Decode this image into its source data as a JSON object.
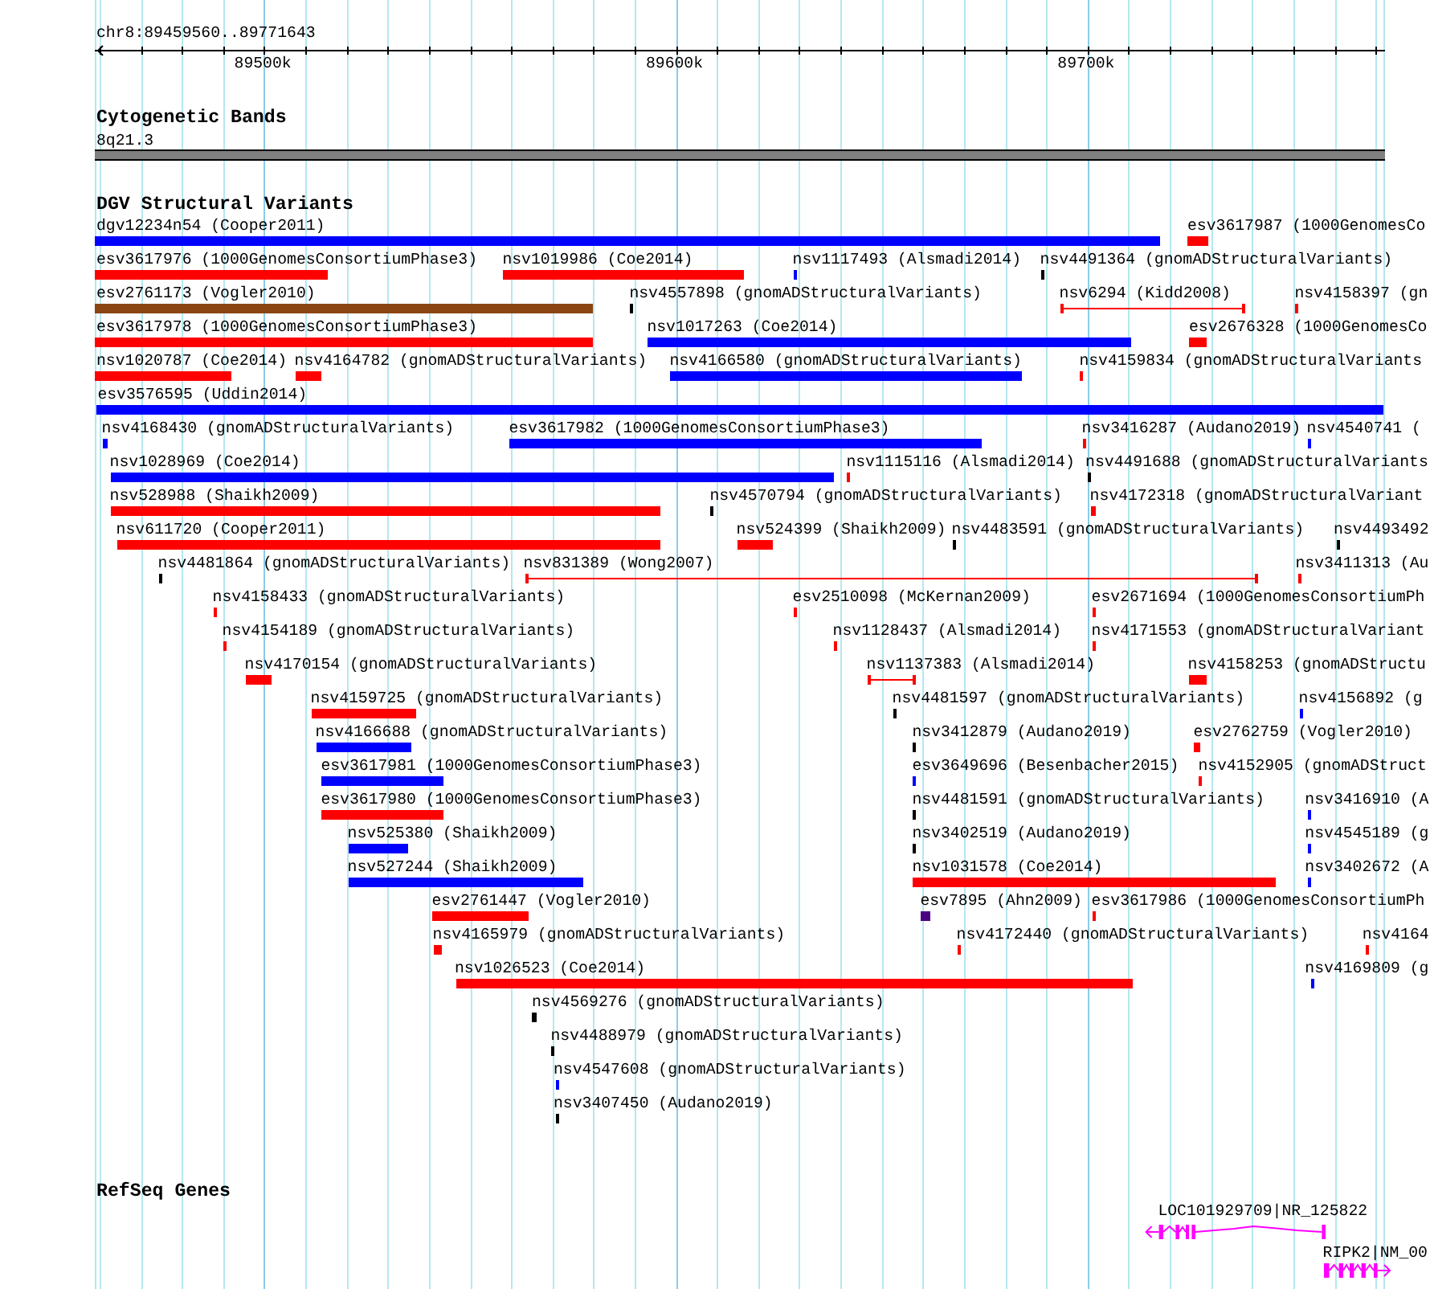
{
  "ruler": {
    "region": "chr8:89459560..89771643",
    "ticks": [
      "89500k",
      "89600k",
      "89700k"
    ]
  },
  "cytogenetic_bands": {
    "title": "Cytogenetic Bands",
    "band": {
      "label": "8q21.3"
    }
  },
  "dgv_variants": {
    "title": "DGV Structural Variants",
    "features": [
      {
        "label": "dgv12234n54 (Cooper2011)",
        "color": "#0000ff",
        "kind": "bar"
      },
      {
        "label": "esv3617987 (1000GenomesCo",
        "color": "#ff0000",
        "kind": "bar"
      },
      {
        "label": "esv3617976 (1000GenomesConsortiumPhase3)",
        "color": "#ff0000",
        "kind": "bar"
      },
      {
        "label": "nsv1019986 (Coe2014)",
        "color": "#ff0000",
        "kind": "bar"
      },
      {
        "label": "nsv1117493 (Alsmadi2014)",
        "color": "#0000ff",
        "kind": "bar"
      },
      {
        "label": "nsv4491364 (gnomADStructuralVariants)",
        "color": "#000000",
        "kind": "bar"
      },
      {
        "label": "esv2761173 (Vogler2010)",
        "color": "#8b4513",
        "kind": "bar"
      },
      {
        "label": "nsv4557898 (gnomADStructuralVariants)",
        "color": "#000000",
        "kind": "bar"
      },
      {
        "label": "nsv6294 (Kidd2008)",
        "color": "#ff0000",
        "kind": "span"
      },
      {
        "label": "nsv4158397 (gn",
        "color": "#ff0000",
        "kind": "bar"
      },
      {
        "label": "esv3617978 (1000GenomesConsortiumPhase3)",
        "color": "#ff0000",
        "kind": "bar"
      },
      {
        "label": "nsv1017263 (Coe2014)",
        "color": "#0000ff",
        "kind": "bar"
      },
      {
        "label": "esv2676328 (1000GenomesCo",
        "color": "#ff0000",
        "kind": "bar"
      },
      {
        "label": "nsv1020787 (Coe2014)",
        "color": "#ff0000",
        "kind": "bar"
      },
      {
        "label": "nsv4164782 (gnomADStructuralVariants)",
        "color": "#ff0000",
        "kind": "bar"
      },
      {
        "label": "nsv4166580 (gnomADStructuralVariants)",
        "color": "#0000ff",
        "kind": "bar"
      },
      {
        "label": "nsv4159834 (gnomADStructuralVariants",
        "color": "#ff0000",
        "kind": "bar"
      },
      {
        "label": "esv3576595 (Uddin2014)",
        "color": "#0000ff",
        "kind": "bar"
      },
      {
        "label": "nsv4168430 (gnomADStructuralVariants)",
        "color": "#0000ff",
        "kind": "bar"
      },
      {
        "label": "esv3617982 (1000GenomesConsortiumPhase3)",
        "color": "#0000ff",
        "kind": "bar"
      },
      {
        "label": "nsv3416287 (Audano2019)",
        "color": "#ff0000",
        "kind": "bar"
      },
      {
        "label": "nsv4540741 (",
        "color": "#0000ff",
        "kind": "bar"
      },
      {
        "label": "nsv1028969 (Coe2014)",
        "color": "#0000ff",
        "kind": "bar"
      },
      {
        "label": "nsv1115116 (Alsmadi2014)",
        "color": "#ff0000",
        "kind": "bar"
      },
      {
        "label": "nsv4491688 (gnomADStructuralVariants",
        "color": "#000000",
        "kind": "bar"
      },
      {
        "label": "nsv528988 (Shaikh2009)",
        "color": "#ff0000",
        "kind": "bar"
      },
      {
        "label": "nsv4570794 (gnomADStructuralVariants)",
        "color": "#000000",
        "kind": "bar"
      },
      {
        "label": "nsv4172318 (gnomADStructuralVariant",
        "color": "#ff0000",
        "kind": "bar"
      },
      {
        "label": "nsv611720 (Cooper2011)",
        "color": "#ff0000",
        "kind": "bar"
      },
      {
        "label": "nsv524399 (Shaikh2009)",
        "color": "#ff0000",
        "kind": "bar"
      },
      {
        "label": "nsv4483591 (gnomADStructuralVariants)",
        "color": "#000000",
        "kind": "bar"
      },
      {
        "label": "nsv4493492",
        "color": "#000000",
        "kind": "bar"
      },
      {
        "label": "nsv4481864 (gnomADStructuralVariants)",
        "color": "#000000",
        "kind": "bar"
      },
      {
        "label": "nsv831389 (Wong2007)",
        "color": "#ff0000",
        "kind": "span"
      },
      {
        "label": "nsv3411313 (Au",
        "color": "#ff0000",
        "kind": "bar"
      },
      {
        "label": "nsv4158433 (gnomADStructuralVariants)",
        "color": "#ff0000",
        "kind": "bar"
      },
      {
        "label": "esv2510098 (McKernan2009)",
        "color": "#ff0000",
        "kind": "bar"
      },
      {
        "label": "esv2671694 (1000GenomesConsortiumPh",
        "color": "#ff0000",
        "kind": "bar"
      },
      {
        "label": "nsv4154189 (gnomADStructuralVariants)",
        "color": "#ff0000",
        "kind": "bar"
      },
      {
        "label": "nsv1128437 (Alsmadi2014)",
        "color": "#ff0000",
        "kind": "bar"
      },
      {
        "label": "nsv4171553 (gnomADStructuralVariant",
        "color": "#ff0000",
        "kind": "bar"
      },
      {
        "label": "nsv4170154 (gnomADStructuralVariants)",
        "color": "#ff0000",
        "kind": "bar"
      },
      {
        "label": "nsv1137383 (Alsmadi2014)",
        "color": "#ff0000",
        "kind": "span"
      },
      {
        "label": "nsv4158253 (gnomADStructu",
        "color": "#ff0000",
        "kind": "bar"
      },
      {
        "label": "nsv4159725 (gnomADStructuralVariants)",
        "color": "#ff0000",
        "kind": "bar"
      },
      {
        "label": "nsv4481597 (gnomADStructuralVariants)",
        "color": "#000000",
        "kind": "bar"
      },
      {
        "label": "nsv4156892 (g",
        "color": "#0000ff",
        "kind": "bar"
      },
      {
        "label": "nsv4166688 (gnomADStructuralVariants)",
        "color": "#0000ff",
        "kind": "bar"
      },
      {
        "label": "nsv3412879 (Audano2019)",
        "color": "#000000",
        "kind": "bar"
      },
      {
        "label": "esv2762759 (Vogler2010)",
        "color": "#ff0000",
        "kind": "bar"
      },
      {
        "label": "esv3617981 (1000GenomesConsortiumPhase3)",
        "color": "#0000ff",
        "kind": "bar"
      },
      {
        "label": "esv3649696 (Besenbacher2015)",
        "color": "#0000ff",
        "kind": "bar"
      },
      {
        "label": "nsv4152905 (gnomADStruct",
        "color": "#ff0000",
        "kind": "bar"
      },
      {
        "label": "esv3617980 (1000GenomesConsortiumPhase3)",
        "color": "#ff0000",
        "kind": "bar"
      },
      {
        "label": "nsv4481591 (gnomADStructuralVariants)",
        "color": "#000000",
        "kind": "bar"
      },
      {
        "label": "nsv3416910 (A",
        "color": "#0000ff",
        "kind": "bar"
      },
      {
        "label": "nsv525380 (Shaikh2009)",
        "color": "#0000ff",
        "kind": "bar"
      },
      {
        "label": "nsv3402519 (Audano2019)",
        "color": "#000000",
        "kind": "bar"
      },
      {
        "label": "nsv4545189 (g",
        "color": "#0000ff",
        "kind": "bar"
      },
      {
        "label": "nsv527244 (Shaikh2009)",
        "color": "#0000ff",
        "kind": "bar"
      },
      {
        "label": "nsv1031578 (Coe2014)",
        "color": "#ff0000",
        "kind": "bar"
      },
      {
        "label": "nsv3402672 (A",
        "color": "#0000ff",
        "kind": "bar"
      },
      {
        "label": "esv2761447 (Vogler2010)",
        "color": "#ff0000",
        "kind": "bar"
      },
      {
        "label": "esv7895 (Ahn2009)",
        "color": "#4b0082",
        "kind": "bar"
      },
      {
        "label": "esv3617986 (1000GenomesConsortiumPh",
        "color": "#ff0000",
        "kind": "bar"
      },
      {
        "label": "nsv4165979 (gnomADStructuralVariants)",
        "color": "#ff0000",
        "kind": "bar"
      },
      {
        "label": "nsv4172440 (gnomADStructuralVariants)",
        "color": "#ff0000",
        "kind": "bar"
      },
      {
        "label": "nsv4164",
        "color": "#ff0000",
        "kind": "bar"
      },
      {
        "label": "nsv1026523 (Coe2014)",
        "color": "#ff0000",
        "kind": "bar"
      },
      {
        "label": "nsv4169809 (g",
        "color": "#0000ff",
        "kind": "bar"
      },
      {
        "label": "nsv4569276 (gnomADStructuralVariants)",
        "color": "#000000",
        "kind": "bar"
      },
      {
        "label": "nsv4488979 (gnomADStructuralVariants)",
        "color": "#000000",
        "kind": "bar"
      },
      {
        "label": "nsv4547608 (gnomADStructuralVariants)",
        "color": "#0000ff",
        "kind": "bar"
      },
      {
        "label": "nsv3407450 (Audano2019)",
        "color": "#000000",
        "kind": "bar"
      }
    ]
  },
  "refseq_genes": {
    "title": "RefSeq Genes",
    "genes": [
      {
        "label": "LOC101929709|NR_125822",
        "reverse": true
      },
      {
        "label": "RIPK2|NM_00",
        "reverse": false
      }
    ]
  }
}
